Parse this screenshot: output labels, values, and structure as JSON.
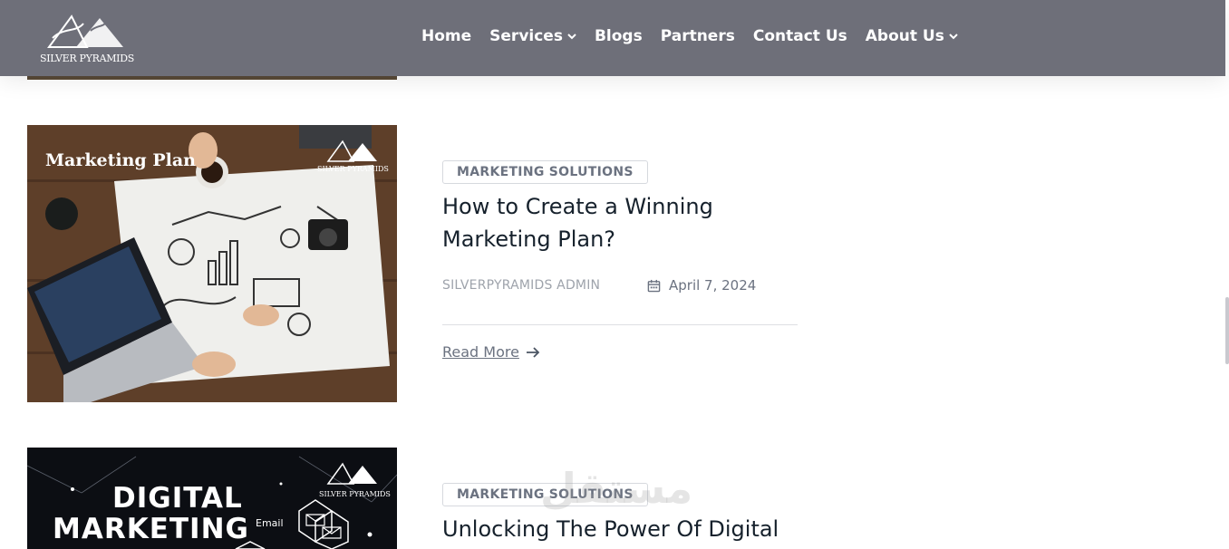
{
  "header": {
    "logo_text": "SILVER PYRAMIDS",
    "nav": [
      {
        "label": "Home",
        "has_dropdown": false
      },
      {
        "label": "Services",
        "has_dropdown": true
      },
      {
        "label": "Blogs",
        "has_dropdown": false
      },
      {
        "label": "Partners",
        "has_dropdown": false
      },
      {
        "label": "Contact Us",
        "has_dropdown": false
      },
      {
        "label": "About Us",
        "has_dropdown": true
      }
    ]
  },
  "posts": [
    {
      "image_title": "Marketing Plan",
      "image_logo": "SILVER PYRAMIDS",
      "category": "MARKETING SOLUTIONS",
      "title": "How to Create a Winning Marketing Plan?",
      "author": "SILVERPYRAMIDS ADMIN",
      "date": "April 7, 2024",
      "read_more": "Read More"
    },
    {
      "image_title_1": "DIGITAL",
      "image_title_2": "MARKETING",
      "image_label": "Email",
      "image_logo": "SILVER PYRAMIDS",
      "category": "MARKETING SOLUTIONS",
      "title": "Unlocking The Power Of Digital"
    }
  ],
  "watermark": "مستقل",
  "colors": {
    "header_bg": "#6e6f79",
    "title_text": "#16212c",
    "muted_text": "#6b7280"
  }
}
